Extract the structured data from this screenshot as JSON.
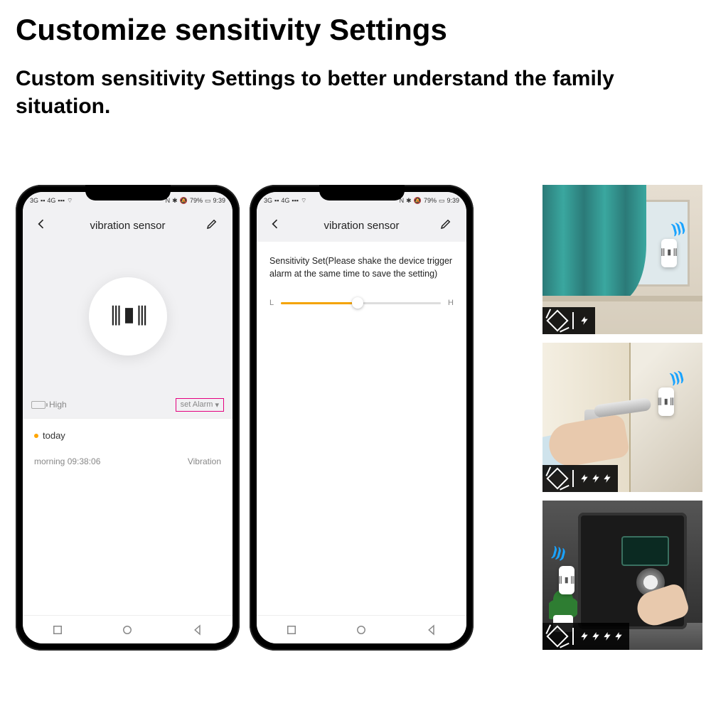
{
  "heading": "Customize sensitivity Settings",
  "subheading": "Custom sensitivity Settings to better understand the family situation.",
  "status_bar": {
    "left_1": "3G",
    "left_2": "4G",
    "signal": "▮▮▮",
    "wifi": "≈",
    "nfc": "N",
    "bt": "✱",
    "mute": "✕",
    "battery_pct": "79%",
    "time": "9:39"
  },
  "phone1": {
    "title": "vibration sensor",
    "battery_level": "High",
    "set_alarm_label": "set Alarm",
    "today_label": "today",
    "log_time_label": "morning  09:38:06",
    "log_event": "Vibration"
  },
  "phone2": {
    "title": "vibration sensor",
    "sensitivity_text": "Sensitivity Set(Please shake the device trigger alarm at the same time to save the setting)",
    "slider_low": "L",
    "slider_high": "H"
  },
  "thumbs": {
    "bolt_counts": [
      1,
      3,
      4
    ]
  }
}
